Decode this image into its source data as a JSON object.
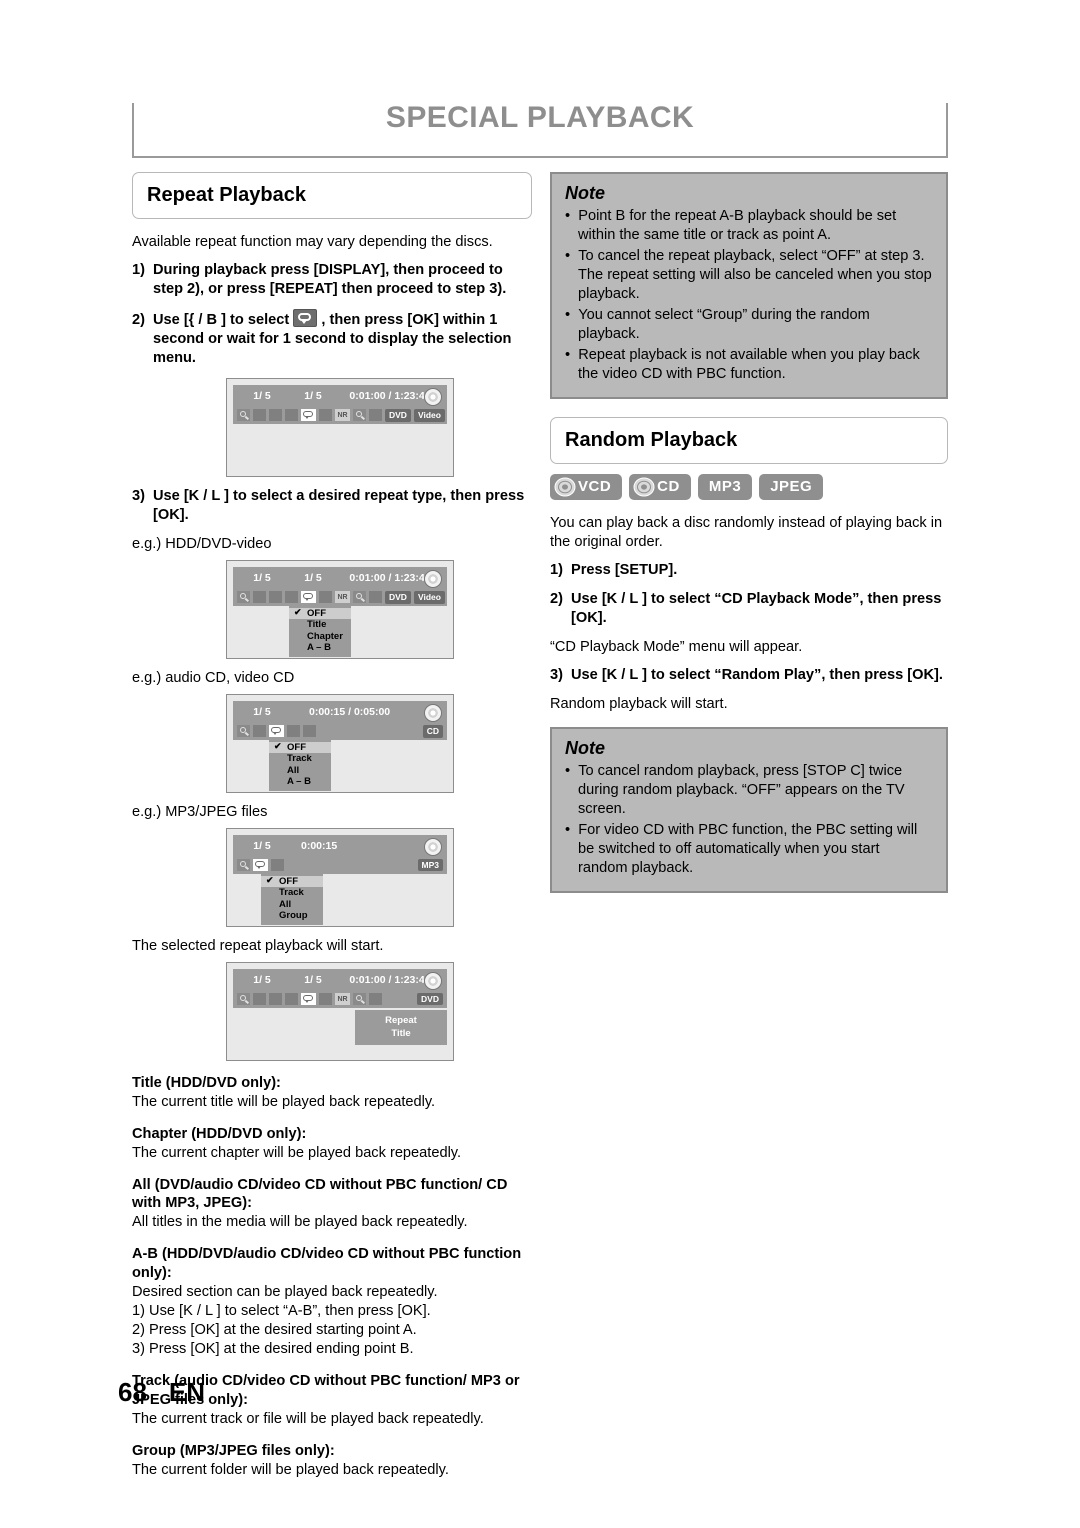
{
  "header": {
    "title": "SPECIAL PLAYBACK"
  },
  "footer": {
    "page": "68",
    "lang": "EN"
  },
  "left": {
    "section_title": "Repeat Playback",
    "intro": "Available repeat function may vary depending the discs.",
    "steps": [
      {
        "num": "1)",
        "text": "During playback press [DISPLAY], then proceed to step 2), or press [REPEAT] then proceed to step 3)."
      },
      {
        "num": "2)",
        "pre": "Use [{ / B ] to select ",
        "post": " , then press [OK] within 1 second or wait for 1 second to display the selection menu."
      },
      {
        "num": "3)",
        "text": "Use [K / L ] to select a desired repeat type, then press [OK]."
      }
    ],
    "eg_labels": {
      "hdd_dvd": "e.g.) HDD/DVD-video",
      "audio_video_cd": "e.g.) audio CD, video CD",
      "mp3_jpeg": "e.g.) MP3/JPEG files"
    },
    "will_start": "The selected repeat playback will start.",
    "definitions": [
      {
        "head": "Title (HDD/DVD only):",
        "body": "The current title will be played back repeatedly."
      },
      {
        "head": "Chapter (HDD/DVD only):",
        "body": "The current chapter will be played back repeatedly."
      },
      {
        "head": "All (DVD/audio CD/video CD without PBC function/ CD with MP3, JPEG):",
        "body": "All titles in the media will be played back repeatedly."
      },
      {
        "head": "A-B (HDD/DVD/audio CD/video CD without PBC function only):",
        "body": "Desired section can be played back repeatedly."
      },
      {
        "head": "Track (audio CD/video CD without PBC function/ MP3 or JPEG files only):",
        "body": "The current track or file will be played back repeatedly."
      },
      {
        "head": "Group (MP3/JPEG files only):",
        "body": "The current folder will be played back repeatedly."
      }
    ],
    "ab_steps": [
      "1) Use [K / L ] to select “A-B”, then press [OK].",
      "2) Press [OK] at the desired starting point A.",
      "3) Press [OK] at the desired ending point B."
    ]
  },
  "right": {
    "note1": {
      "title": "Note",
      "items": [
        "Point B for the repeat A-B playback should be set within the same title or track as point A.",
        "To cancel the repeat playback, select “OFF” at step 3. The repeat setting will also be canceled when you stop playback.",
        "You cannot select “Group” during the random playback.",
        "Repeat playback is not available when you play back the video CD with PBC function."
      ]
    },
    "section_title": "Random Playback",
    "badges": [
      "VCD",
      "CD",
      "MP3",
      "JPEG"
    ],
    "intro": "You can play back a disc randomly instead of playing back in the original order.",
    "steps": [
      {
        "num": "1)",
        "text": "Press [SETUP]."
      },
      {
        "num": "2)",
        "text": "Use [K / L ] to select “CD Playback Mode”, then press [OK].",
        "sub": "“CD Playback Mode” menu will appear."
      },
      {
        "num": "3)",
        "text": "Use [K / L ] to select “Random Play”, then press [OK].",
        "sub": "Random playback will start."
      }
    ],
    "note2": {
      "title": "Note",
      "items": [
        "To cancel random playback, press [STOP C] twice during random playback. “OFF” appears on the TV screen.",
        "For video CD with PBC function, the PBC setting will be switched to off automatically when you start random playback."
      ]
    }
  },
  "figures": {
    "fig1": {
      "title1": "1/ 5",
      "title2": "1/ 5",
      "time": "0:01:00 / 1:23:45",
      "nr": "NR",
      "tags": [
        "DVD",
        "Video"
      ],
      "menu": []
    },
    "fig2": {
      "title1": "1/ 5",
      "title2": "1/ 5",
      "time": "0:01:00 / 1:23:45",
      "nr": "NR",
      "tags": [
        "DVD",
        "Video"
      ],
      "menu": [
        "OFF",
        "Title",
        "Chapter",
        "A – B"
      ]
    },
    "fig3": {
      "title1": "1/ 5",
      "title2": "",
      "time": "0:00:15 / 0:05:00",
      "nr": "",
      "tags": [
        "CD"
      ],
      "menu": [
        "OFF",
        "Track",
        "All",
        "A – B"
      ]
    },
    "fig4": {
      "title1": "1/ 5",
      "title2": "",
      "time": "0:00:15",
      "nr": "",
      "tags": [
        "MP3"
      ],
      "menu": [
        "OFF",
        "Track",
        "All",
        "Group"
      ]
    },
    "fig5": {
      "title1": "1/ 5",
      "title2": "1/ 5",
      "time": "0:01:00 / 1:23:45",
      "nr": "NR",
      "tags": [
        "DVD"
      ],
      "indicator_line1": "Repeat",
      "indicator_line2": "Title"
    }
  }
}
